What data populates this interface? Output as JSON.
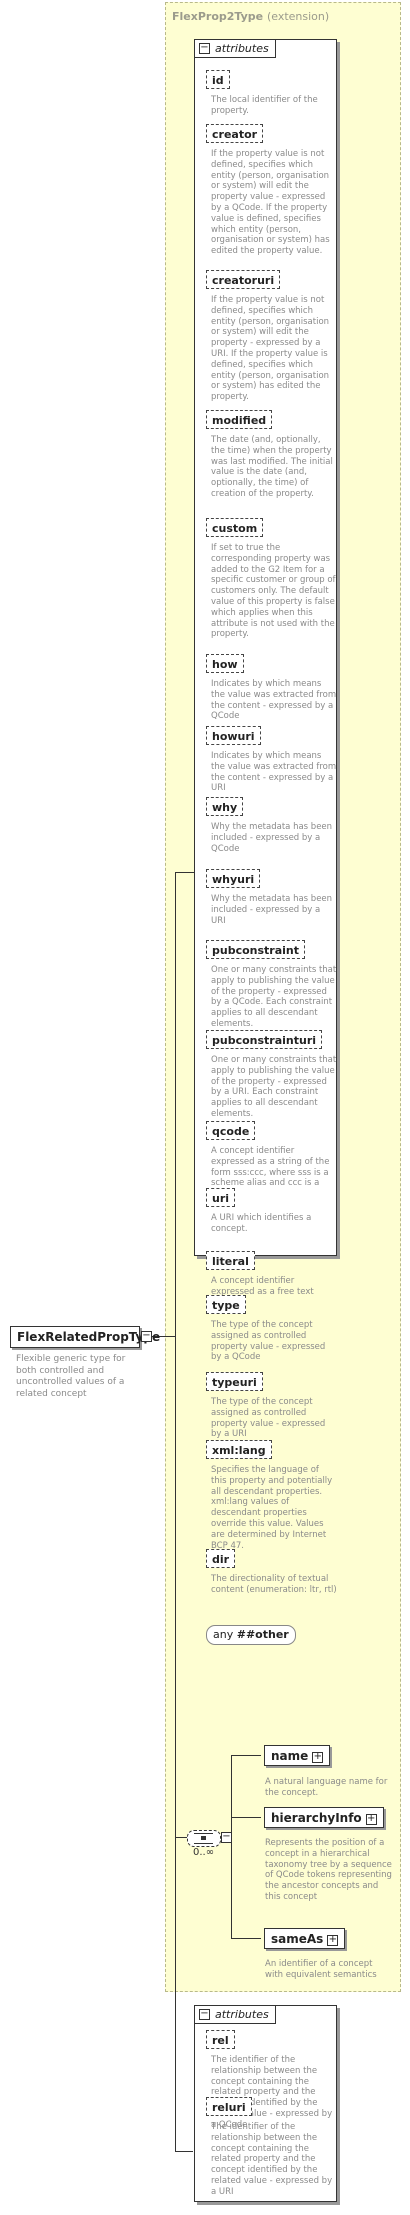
{
  "extension": {
    "name": "FlexProp2Type",
    "kind": "(extension)"
  },
  "attr_group1": {
    "header": "attributes",
    "items": [
      {
        "name": "id",
        "desc": "The local identifier of the property."
      },
      {
        "name": "creator",
        "desc": "If the property value is not defined, specifies which entity (person, organisation or system) will edit the property value - expressed by a QCode. If the property value is defined, specifies which entity (person, organisation or system) has edited the property value."
      },
      {
        "name": "creatoruri",
        "desc": "If the property value is not defined, specifies which entity (person, organisation or system) will edit the property - expressed by a URI. If the property value is defined, specifies which entity (person, organisation or system) has edited the property."
      },
      {
        "name": "modified",
        "desc": "The date (and, optionally, the time) when the property was last modified. The initial value is the date (and, optionally, the time) of creation of the property."
      },
      {
        "name": "custom",
        "desc": "If set to true the corresponding property was added to the G2 Item for a specific customer or group of customers only. The default value of this property is false which applies when this attribute is not used with the property."
      },
      {
        "name": "how",
        "desc": "Indicates by which means the value was extracted from the content - expressed by a QCode"
      },
      {
        "name": "howuri",
        "desc": "Indicates by which means the value was extracted from the content - expressed by a URI"
      },
      {
        "name": "why",
        "desc": "Why the metadata has been included - expressed by a QCode"
      },
      {
        "name": "whyuri",
        "desc": "Why the metadata has been included - expressed by a URI"
      },
      {
        "name": "pubconstraint",
        "desc": "One or many constraints that apply to publishing the value of the property - expressed by a QCode. Each constraint applies to all descendant elements."
      },
      {
        "name": "pubconstrainturi",
        "desc": "One or many constraints that apply to publishing the value of the property - expressed by a URI. Each constraint applies to all descendant elements."
      },
      {
        "name": "qcode",
        "desc": "A concept identifier expressed as a string of the form sss:ccc, where sss is a scheme alias and ccc is a code"
      },
      {
        "name": "uri",
        "desc": "A URI which identifies a concept."
      },
      {
        "name": "literal",
        "desc": "A concept identifier expressed as a free text string"
      },
      {
        "name": "type",
        "desc": "The type of the concept assigned as controlled property value - expressed by a QCode"
      },
      {
        "name": "typeuri",
        "desc": "The type of the concept assigned as controlled property value - expressed by a URI"
      },
      {
        "name": "xml:lang",
        "desc": "Specifies the language of this property and potentially all descendant properties. xml:lang values of descendant properties override this value. Values are determined by Internet BCP 47."
      },
      {
        "name": "dir",
        "desc": "The directionality of textual content (enumeration: ltr, rtl)"
      }
    ],
    "any_label": "any",
    "any_value": "##other"
  },
  "root": {
    "name": "FlexRelatedPropType",
    "desc": "Flexible generic type for both controlled and uncontrolled values of a related concept"
  },
  "sequence": {
    "occurrence": "0..∞"
  },
  "elements": [
    {
      "name": "name",
      "desc": "A natural language name for the concept."
    },
    {
      "name": "hierarchyInfo",
      "desc": "Represents the position of a concept in a hierarchical taxonomy tree by a sequence of QCode tokens representing the ancestor concepts and this concept"
    },
    {
      "name": "sameAs",
      "desc": "An identifier of a concept with equivalent semantics"
    }
  ],
  "attr_group2": {
    "header": "attributes",
    "items": [
      {
        "name": "rel",
        "desc": "The identifier of the relationship between the concept containing the related property and the concept identified by the related value - expressed by a QCode"
      },
      {
        "name": "reluri",
        "desc": "The identifier of the relationship between the concept containing the related property and the concept identified by the related value - expressed by a URI"
      }
    ]
  }
}
